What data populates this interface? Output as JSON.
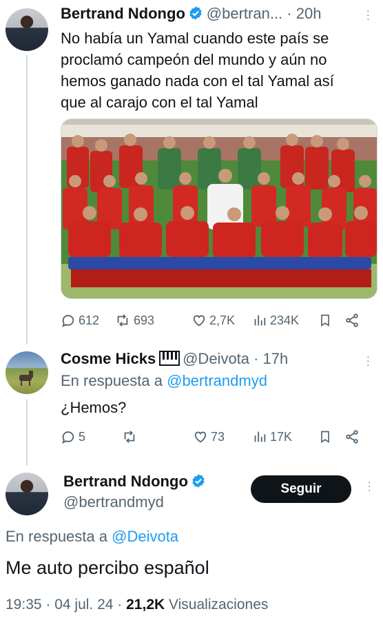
{
  "tweet1": {
    "author_name": "Bertrand Ndongo",
    "handle_time": "@bertran... · 20h",
    "text_lines": [
      "No había un Yamal cuando este país se",
      "proclamó campeón del mundo y aún no",
      "hemos ganado nada con el tal Yamal así",
      "que al carajo con el tal Yamal"
    ],
    "replies": "612",
    "reposts": "693",
    "likes": "2,7K",
    "views": "234K"
  },
  "tweet2": {
    "author_name": "Cosme Hicks",
    "handle_time": "@Deivota · 17h",
    "reply_prefix": "En respuesta a",
    "reply_to": "@bertrandmyd",
    "text": "¿Hemos?",
    "replies": "5",
    "reposts": "",
    "likes": "73",
    "views": "17K"
  },
  "tweet3": {
    "author_name": "Bertrand Ndongo",
    "handle": "@bertrandmyd",
    "follow_label": "Seguir",
    "reply_prefix": "En respuesta a",
    "reply_to": "@Deivota",
    "text": "Me auto percibo español",
    "meta_time": "19:35 · 04 jul. 24 ·",
    "meta_views_count": "21,2K",
    "meta_views_label": "Visualizaciones"
  },
  "colors": {
    "link": "#1d9bf0",
    "muted": "#536471",
    "text": "#0f1419",
    "verified": "#1d9bf0"
  }
}
